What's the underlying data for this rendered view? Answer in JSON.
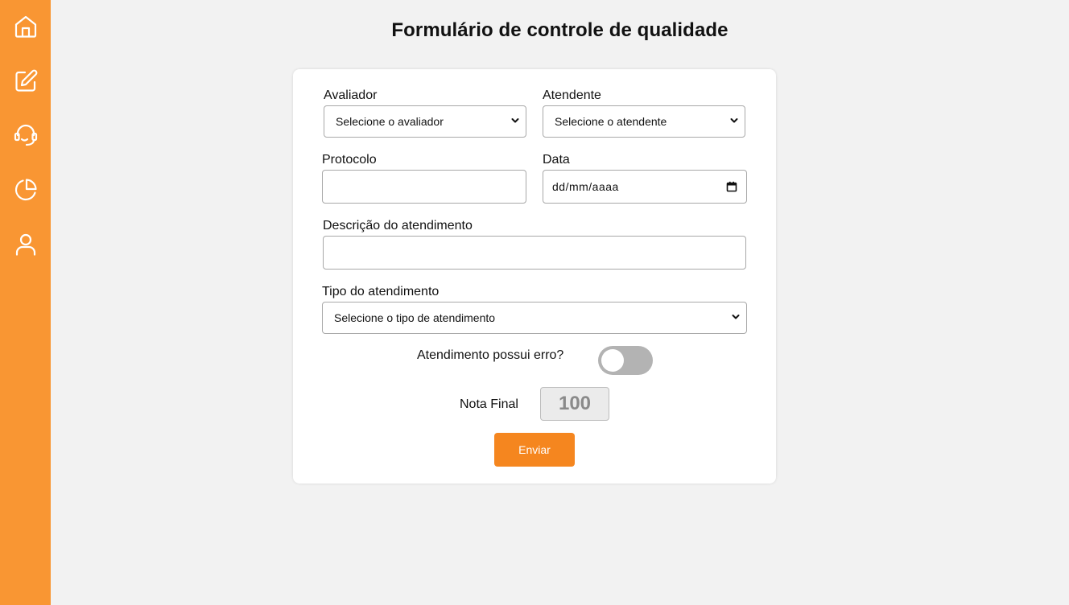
{
  "sidebar": {
    "items": [
      {
        "icon": "home-icon"
      },
      {
        "icon": "edit-form-icon"
      },
      {
        "icon": "headset-icon"
      },
      {
        "icon": "pie-chart-icon"
      },
      {
        "icon": "user-icon"
      }
    ],
    "color": "#f99633"
  },
  "page": {
    "title": "Formulário de controle de qualidade"
  },
  "form": {
    "evaluator": {
      "label": "Avaliador",
      "value": "Selecione o avaliador"
    },
    "attendant": {
      "label": "Atendente",
      "value": "Selecione o atendente"
    },
    "protocol": {
      "label": "Protocolo",
      "value": ""
    },
    "date": {
      "label": "Data",
      "placeholder": "dd/mm/aaaa"
    },
    "description": {
      "label": "Descrição do atendimento",
      "value": ""
    },
    "service_type": {
      "label": "Tipo do atendimento",
      "value": "Selecione o tipo de atendimento"
    },
    "has_error": {
      "label": "Atendimento possui erro?",
      "checked": false
    },
    "final_score": {
      "label": "Nota Final",
      "value": "100"
    },
    "submit_label": "Enviar"
  },
  "colors": {
    "accent": "#f5861f",
    "background": "#f2f2f2",
    "toggle_off": "#b3b3b3"
  }
}
